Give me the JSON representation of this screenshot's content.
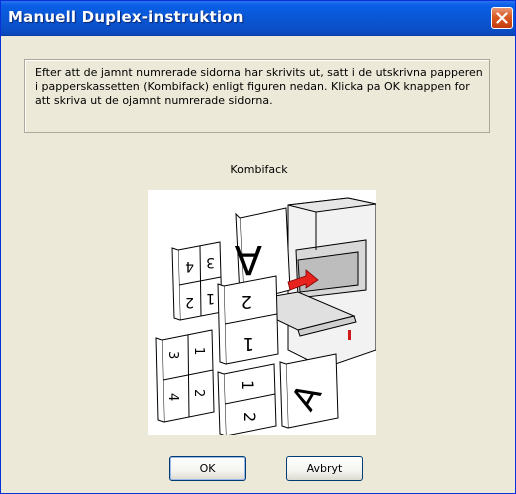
{
  "window": {
    "title": "Manuell Duplex-instruktion"
  },
  "message": "Efter att de jamnt numrerade sidorna har skrivits ut, satt i de utskrivna papperen i papperskassetten (Kombifack) enligt figuren nedan. Klicka pa OK knappen for att skriva ut de ojamnt numrerade sidorna.",
  "tray_label": "Kombifack",
  "buttons": {
    "ok": "OK",
    "cancel": "Avbryt"
  },
  "colors": {
    "titlebar": "#0a58d8",
    "close_button": "#d9581f",
    "dialog_bg": "#ece9d8",
    "arrow": "#e8221c"
  }
}
